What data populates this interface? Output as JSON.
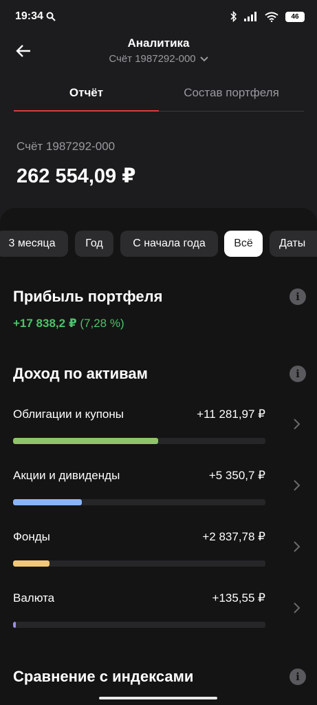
{
  "status": {
    "time": "19:34",
    "battery": "46"
  },
  "header": {
    "title": "Аналитика",
    "account": "Счёт 1987292-000"
  },
  "tabs": [
    {
      "label": "Отчёт",
      "active": true
    },
    {
      "label": "Состав портфеля",
      "active": false
    }
  ],
  "summary": {
    "account_label": "Счёт 1987292-000",
    "total": "262 554,09 ₽"
  },
  "periods": [
    {
      "label": "3 месяца",
      "active": false
    },
    {
      "label": "Год",
      "active": false
    },
    {
      "label": "С начала года",
      "active": false
    },
    {
      "label": "Всё",
      "active": true
    },
    {
      "label": "Даты",
      "active": false
    }
  ],
  "profit": {
    "title": "Прибыль портфеля",
    "value": "+17 838,2 ₽",
    "percent": "(7,28 %)"
  },
  "income": {
    "title": "Доход по активам",
    "assets": [
      {
        "name": "Облигации и купоны",
        "value": "+11 281,97 ₽",
        "share": 0.575,
        "color": "#8fc46a"
      },
      {
        "name": "Акции и дивиденды",
        "value": "+5 350,7 ₽",
        "share": 0.272,
        "color": "#8ab4f8"
      },
      {
        "name": "Фонды",
        "value": "+2 837,78 ₽",
        "share": 0.145,
        "color": "#f1c87a"
      },
      {
        "name": "Валюта",
        "value": "+135,55 ₽",
        "share": 0.008,
        "color": "#9c8fe0"
      }
    ]
  },
  "comparison": {
    "title": "Сравнение с индексами"
  },
  "colors": {
    "accent": "#e0393e",
    "positive": "#4cc36a",
    "background": "#1c1c1e",
    "panel": "#141414"
  }
}
